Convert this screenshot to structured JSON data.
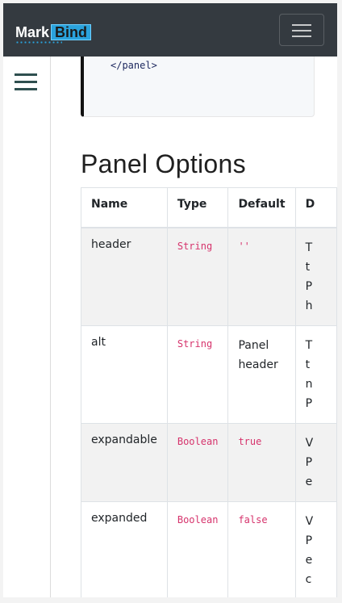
{
  "navbar": {
    "brand_mark": "Mark",
    "brand_bind": "Bind",
    "colors": {
      "background": "#343a40",
      "accent": "#2aa2dc"
    }
  },
  "code": {
    "line": "</panel>"
  },
  "section": {
    "title": "Panel Options"
  },
  "table": {
    "headers": [
      "Name",
      "Type",
      "Default",
      "D"
    ],
    "rows": [
      {
        "name": "header",
        "type": "String",
        "default": "''",
        "desc": "T\nt\nP\nh"
      },
      {
        "name": "alt",
        "type": "String",
        "default": "Panel header",
        "desc": "T\nt\nn\nP"
      },
      {
        "name": "expandable",
        "type": "Boolean",
        "default": "true",
        "desc": "V\nP\ne"
      },
      {
        "name": "expanded",
        "type": "Boolean",
        "default": "false",
        "desc": "V\nP\ne\nc"
      }
    ]
  }
}
